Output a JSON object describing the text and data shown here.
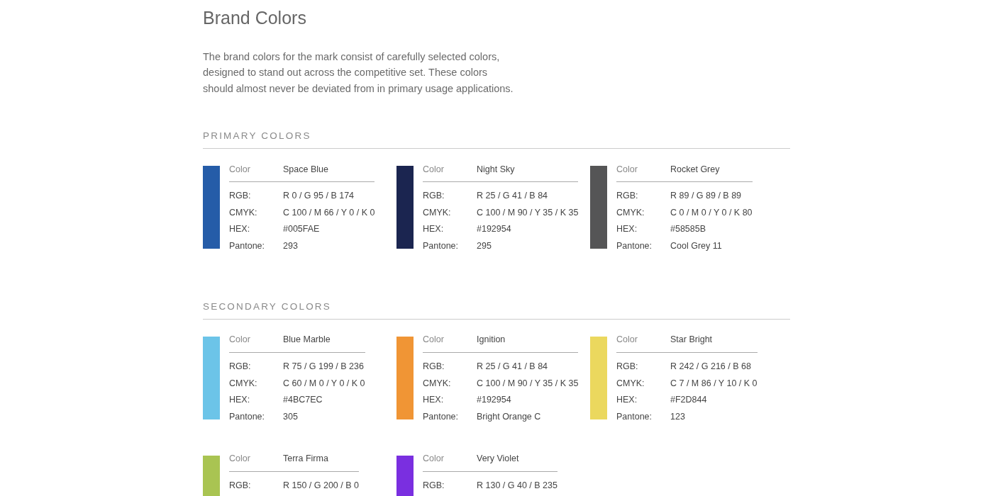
{
  "title": "Brand Colors",
  "intro": "The brand colors for the mark consist of carefully selected colors, designed to stand out across the competitive set. These colors should almost never be deviated from in primary usage applications.",
  "sections": [
    {
      "heading": "PRIMARY COLORS",
      "swatches": [
        {
          "color": "#255ca8",
          "name_label": "Color",
          "name": "Space Blue",
          "specs": [
            {
              "label": "RGB:",
              "value": "R 0 / G 95 / B 174"
            },
            {
              "label": "CMYK:",
              "value": "C 100 / M 66 / Y 0 / K 0"
            },
            {
              "label": "HEX:",
              "value": "#005FAE"
            },
            {
              "label": "Pantone:",
              "value": "293"
            }
          ]
        },
        {
          "color": "#1b2550",
          "name_label": "Color",
          "name": "Night Sky",
          "specs": [
            {
              "label": "RGB:",
              "value": "R 25 / G 41 / B 84"
            },
            {
              "label": "CMYK:",
              "value": "C 100 / M 90 / Y 35 / K 35"
            },
            {
              "label": "HEX:",
              "value": "#192954"
            },
            {
              "label": "Pantone:",
              "value": "295"
            }
          ]
        },
        {
          "color": "#555556",
          "name_label": "Color",
          "name": "Rocket Grey",
          "specs": [
            {
              "label": "RGB:",
              "value": "R 89 / G 89 / B 89"
            },
            {
              "label": "CMYK:",
              "value": "C 0 / M 0 / Y 0 / K 80"
            },
            {
              "label": "HEX:",
              "value": "#58585B"
            },
            {
              "label": "Pantone:",
              "value": "Cool Grey 11"
            }
          ]
        }
      ]
    },
    {
      "heading": "SECONDARY COLORS",
      "swatches": [
        {
          "color": "#6cc4e8",
          "name_label": "Color",
          "name": "Blue Marble",
          "specs": [
            {
              "label": "RGB:",
              "value": "R 75 / G 199 / B 236"
            },
            {
              "label": "CMYK:",
              "value": "C 60 / M 0 / Y 0 / K 0"
            },
            {
              "label": "HEX:",
              "value": "#4BC7EC"
            },
            {
              "label": "Pantone:",
              "value": "305"
            }
          ]
        },
        {
          "color": "#f09535",
          "name_label": "Color",
          "name": "Ignition",
          "specs": [
            {
              "label": "RGB:",
              "value": "R 25 / G 41 / B 84"
            },
            {
              "label": "CMYK:",
              "value": "C 100 / M 90 / Y 35 / K 35"
            },
            {
              "label": "HEX:",
              "value": "#192954"
            },
            {
              "label": "Pantone:",
              "value": "Bright Orange C"
            }
          ]
        },
        {
          "color": "#ebd85e",
          "name_label": "Color",
          "name": "Star Bright",
          "specs": [
            {
              "label": "RGB:",
              "value": "R 242 / G 216 / B 68"
            },
            {
              "label": "CMYK:",
              "value": "C 7 / M 86 / Y 10 / K 0"
            },
            {
              "label": "HEX:",
              "value": "#F2D844"
            },
            {
              "label": "Pantone:",
              "value": "123"
            }
          ]
        },
        {
          "color": "#a9c452",
          "name_label": "Color",
          "name": "Terra Firma",
          "specs": [
            {
              "label": "RGB:",
              "value": "R 150 / G 200 / B 0"
            }
          ]
        },
        {
          "color": "#7a2fe0",
          "name_label": "Color",
          "name": "Very Violet",
          "specs": [
            {
              "label": "RGB:",
              "value": "R 130 / G 40 / B 235"
            }
          ]
        }
      ]
    }
  ]
}
